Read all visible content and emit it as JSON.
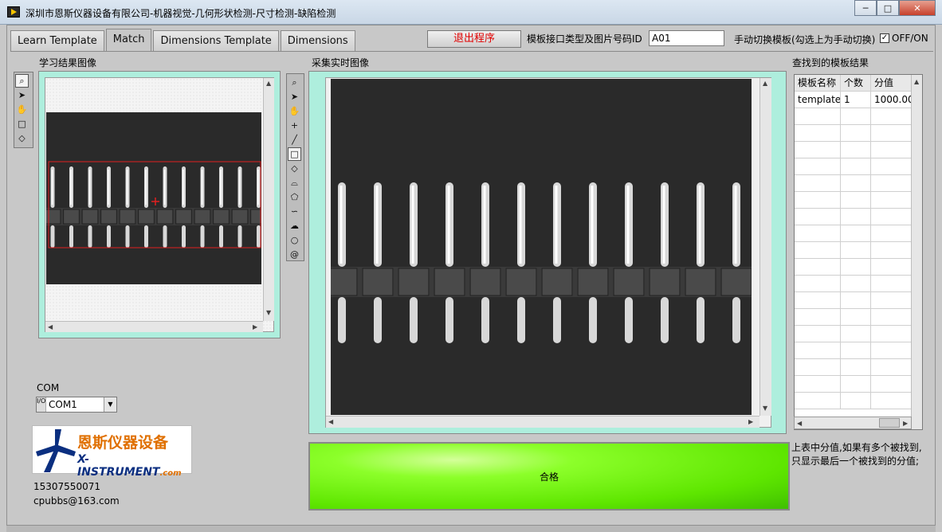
{
  "window": {
    "title": "深圳市恩斯仪器设备有限公司-机器视觉-几何形状检测-尺寸检测-缺陷检测",
    "buttons": {
      "minimize": "─",
      "restore": "□",
      "close": "✕"
    }
  },
  "tabs": [
    {
      "label": "Learn Template",
      "active": false
    },
    {
      "label": "Match",
      "active": true
    },
    {
      "label": "Dimensions Template",
      "active": false
    },
    {
      "label": "Dimensions",
      "active": false
    }
  ],
  "header": {
    "exit_label": "退出程序",
    "id_label": "模板接口类型及图片号码ID",
    "id_value": "A01",
    "manual_label": "手动切换模板(勾选上为手动切换)",
    "manual_checked": "✓",
    "manual_toggle_label": "OFF/ON"
  },
  "learn_panel": {
    "title": "学习结果图像"
  },
  "live_panel": {
    "title": "采集实时图像"
  },
  "results_panel": {
    "title": "查找到的模板结果",
    "columns": [
      "模板名称",
      "个数",
      "分值"
    ],
    "rows": [
      [
        "template",
        "1",
        "1000.00"
      ]
    ]
  },
  "result": {
    "label": "合格",
    "color": "#5ee600"
  },
  "note": {
    "line1": "上表中分值,如果有多个被找到,",
    "line2": "只显示最后一个被找到的分值;"
  },
  "com": {
    "label": "COM",
    "value": "COM1",
    "io_glyph": "I/O"
  },
  "logo": {
    "cn": "恩斯仪器设备",
    "en": "X-INSTRUMENT",
    "en_suffix": ".com"
  },
  "contact": {
    "phone": "15307550071",
    "email": "cpubbs@163.com"
  },
  "colors": {
    "panel_frame": "#aeeedd",
    "exit_text": "#e00000",
    "roi": "#e02020"
  }
}
